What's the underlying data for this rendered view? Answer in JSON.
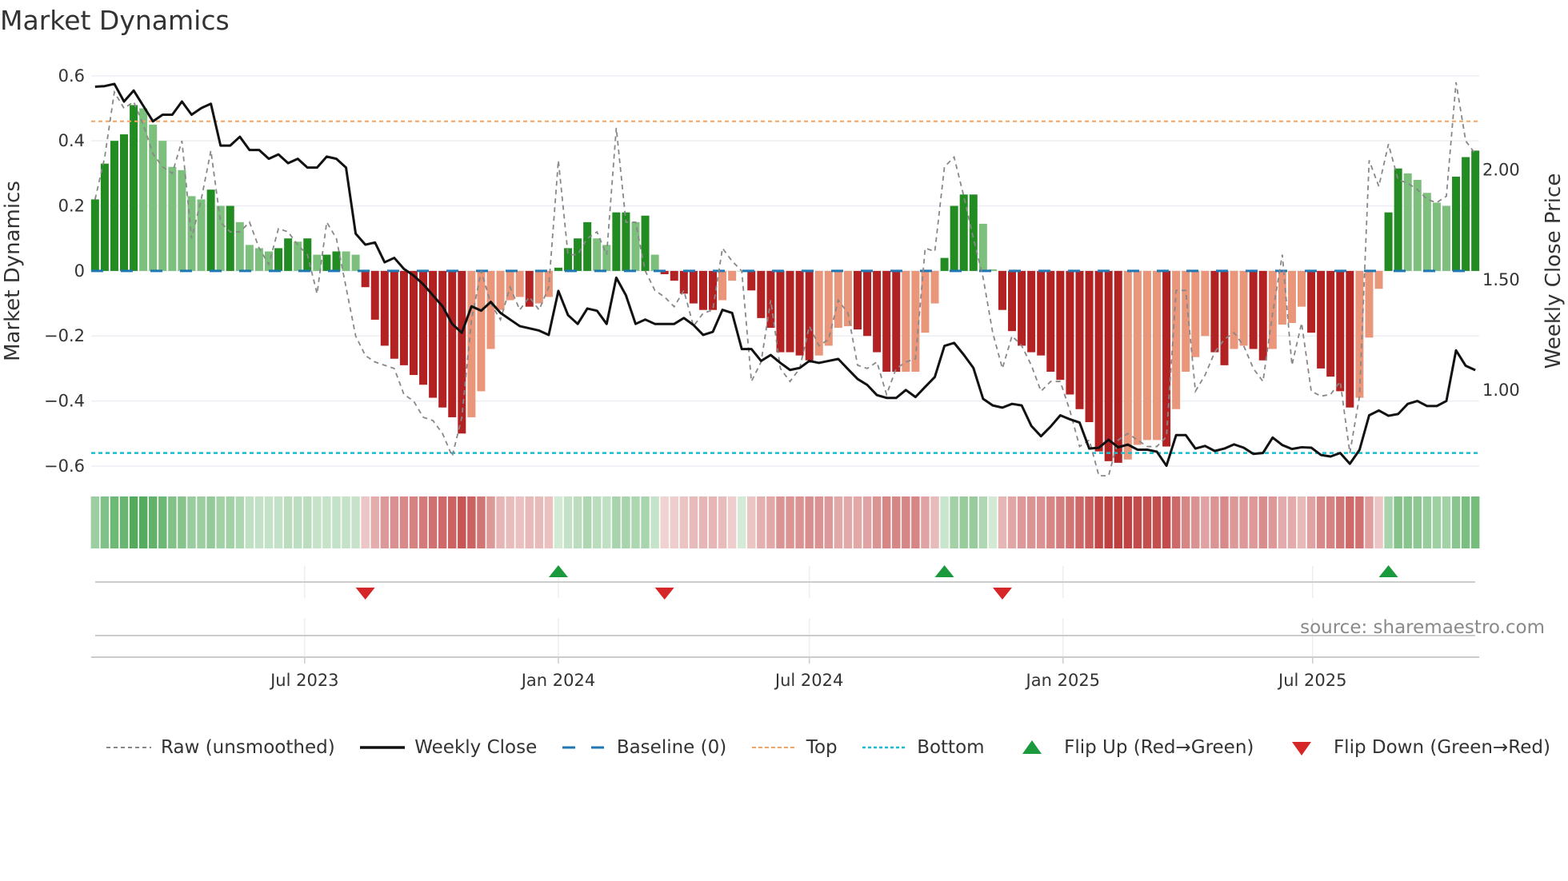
{
  "chart_data": {
    "type": "bar",
    "title": "Market Dynamics",
    "ylabel": "Market Dynamics",
    "y2label": "Weekly Close Price",
    "ylim": [
      -0.637,
      0.634
    ],
    "y2lim": [
      0.6,
      2.477
    ],
    "yticks": [
      {
        "value": 0.6,
        "label": "0.6"
      },
      {
        "value": 0.4,
        "label": "0.4"
      },
      {
        "value": 0.2,
        "label": "0.2"
      },
      {
        "value": 0,
        "label": "0"
      },
      {
        "value": -0.2,
        "label": "−0.2"
      },
      {
        "value": -0.4,
        "label": "−0.4"
      },
      {
        "value": -0.6,
        "label": "−0.6"
      }
    ],
    "y2ticks": [
      {
        "value": 2.0,
        "label": "2.00"
      },
      {
        "value": 1.5,
        "label": "1.50"
      },
      {
        "value": 1.0,
        "label": "1.00"
      }
    ],
    "xticks": [
      {
        "date": "2023-07-01",
        "label": "Jul 2023"
      },
      {
        "date": "2024-01-01",
        "label": "Jan 2024"
      },
      {
        "date": "2024-07-01",
        "label": "Jul 2024"
      },
      {
        "date": "2025-01-01",
        "label": "Jan 2025"
      },
      {
        "date": "2025-07-01",
        "label": "Jul 2025"
      }
    ],
    "start_date": "2023-01-30",
    "interval": "weekly",
    "values": [
      0.22,
      0.33,
      0.4,
      0.42,
      0.51,
      0.5,
      0.45,
      0.4,
      0.32,
      0.31,
      0.23,
      0.22,
      0.25,
      0.2,
      0.2,
      0.15,
      0.08,
      0.07,
      0.06,
      0.07,
      0.1,
      0.09,
      0.1,
      0.05,
      0.05,
      0.06,
      0.06,
      0.05,
      -0.05,
      -0.15,
      -0.23,
      -0.27,
      -0.29,
      -0.32,
      -0.35,
      -0.39,
      -0.42,
      -0.45,
      -0.5,
      -0.45,
      -0.37,
      -0.24,
      -0.12,
      -0.09,
      -0.08,
      -0.11,
      -0.1,
      -0.08,
      0.01,
      0.07,
      0.1,
      0.15,
      0.1,
      0.08,
      0.18,
      0.18,
      0.15,
      0.17,
      0.05,
      -0.01,
      -0.03,
      -0.07,
      -0.1,
      -0.12,
      -0.12,
      -0.09,
      -0.03,
      0.0,
      -0.06,
      -0.145,
      -0.175,
      -0.25,
      -0.25,
      -0.26,
      -0.275,
      -0.26,
      -0.23,
      -0.175,
      -0.17,
      -0.18,
      -0.2,
      -0.25,
      -0.31,
      -0.31,
      -0.31,
      -0.31,
      -0.19,
      -0.1,
      0.04,
      0.2,
      0.235,
      0.235,
      0.145,
      0.005,
      -0.12,
      -0.185,
      -0.23,
      -0.25,
      -0.26,
      -0.31,
      -0.335,
      -0.38,
      -0.425,
      -0.465,
      -0.555,
      -0.585,
      -0.59,
      -0.58,
      -0.535,
      -0.52,
      -0.52,
      -0.54,
      -0.425,
      -0.31,
      -0.265,
      -0.2,
      -0.25,
      -0.29,
      -0.24,
      -0.23,
      -0.24,
      -0.275,
      -0.24,
      -0.165,
      -0.16,
      -0.11,
      -0.19,
      -0.3,
      -0.325,
      -0.37,
      -0.42,
      -0.39,
      -0.205,
      -0.055,
      0.18,
      0.315,
      0.3,
      0.28,
      0.24,
      0.21,
      0.2,
      0.29,
      0.35,
      0.37
    ],
    "strong": [
      1,
      1,
      1,
      1,
      1,
      0,
      0,
      0,
      0,
      0,
      0,
      0,
      1,
      0,
      1,
      0,
      0,
      0,
      0,
      1,
      1,
      0,
      1,
      0,
      1,
      1,
      0,
      0,
      1,
      1,
      1,
      1,
      1,
      1,
      1,
      1,
      1,
      1,
      1,
      0,
      0,
      0,
      0,
      0,
      0,
      1,
      0,
      0,
      1,
      1,
      1,
      1,
      0,
      0,
      1,
      1,
      0,
      1,
      0,
      1,
      1,
      1,
      1,
      1,
      1,
      0,
      0,
      0,
      1,
      1,
      1,
      1,
      1,
      1,
      1,
      0,
      0,
      0,
      0,
      1,
      1,
      1,
      1,
      1,
      0,
      0,
      0,
      0,
      1,
      1,
      1,
      1,
      0,
      0,
      1,
      1,
      1,
      1,
      1,
      1,
      1,
      1,
      1,
      1,
      1,
      1,
      1,
      0,
      0,
      0,
      0,
      1,
      0,
      0,
      0,
      0,
      1,
      1,
      0,
      0,
      1,
      1,
      0,
      0,
      0,
      0,
      1,
      1,
      1,
      1,
      1,
      0,
      0,
      0,
      1,
      1,
      0,
      0,
      0,
      0,
      0,
      1,
      1,
      1
    ],
    "raw": [
      0.22,
      0.35,
      0.55,
      0.5,
      0.52,
      0.45,
      0.36,
      0.32,
      0.3,
      0.4,
      0.1,
      0.22,
      0.37,
      0.15,
      0.12,
      0.12,
      0.15,
      0.07,
      0.02,
      0.13,
      0.12,
      0.08,
      0.05,
      -0.07,
      0.15,
      0.1,
      -0.05,
      -0.2,
      -0.26,
      -0.28,
      -0.29,
      -0.3,
      -0.38,
      -0.4,
      -0.45,
      -0.46,
      -0.5,
      -0.57,
      -0.45,
      -0.15,
      0.0,
      -0.1,
      -0.15,
      -0.05,
      -0.12,
      -0.08,
      -0.12,
      -0.05,
      0.34,
      0.05,
      0.05,
      0.1,
      0.12,
      0.05,
      0.44,
      0.15,
      0.15,
      0.0,
      -0.06,
      -0.08,
      -0.11,
      -0.06,
      -0.17,
      -0.13,
      -0.12,
      0.07,
      0.03,
      0.0,
      -0.34,
      -0.28,
      -0.09,
      -0.3,
      -0.34,
      -0.3,
      -0.17,
      -0.23,
      -0.21,
      -0.09,
      -0.13,
      -0.29,
      -0.3,
      -0.28,
      -0.38,
      -0.3,
      -0.28,
      -0.27,
      0.07,
      0.06,
      0.32,
      0.35,
      0.23,
      0.1,
      -0.02,
      -0.19,
      -0.3,
      -0.2,
      -0.23,
      -0.29,
      -0.37,
      -0.34,
      -0.34,
      -0.43,
      -0.54,
      -0.52,
      -0.63,
      -0.63,
      -0.52,
      -0.5,
      -0.52,
      -0.54,
      -0.54,
      -0.51,
      -0.06,
      -0.06,
      -0.37,
      -0.32,
      -0.25,
      -0.21,
      -0.19,
      -0.23,
      -0.3,
      -0.34,
      -0.13,
      0.05,
      -0.29,
      -0.16,
      -0.37,
      -0.385,
      -0.38,
      -0.34,
      -0.56,
      -0.385,
      0.34,
      0.26,
      0.39,
      0.28,
      0.27,
      0.25,
      0.22,
      0.21,
      0.23,
      0.58,
      0.4,
      0.36
    ],
    "close": [
      2.377,
      2.38,
      2.39,
      2.31,
      2.36,
      2.29,
      2.22,
      2.25,
      2.25,
      2.31,
      2.25,
      2.28,
      2.3,
      2.11,
      2.11,
      2.15,
      2.09,
      2.09,
      2.05,
      2.07,
      2.03,
      2.05,
      2.01,
      2.01,
      2.06,
      2.05,
      2.01,
      1.71,
      1.66,
      1.67,
      1.58,
      1.6,
      1.55,
      1.52,
      1.48,
      1.43,
      1.38,
      1.3,
      1.26,
      1.38,
      1.36,
      1.4,
      1.35,
      1.32,
      1.29,
      1.28,
      1.27,
      1.25,
      1.45,
      1.34,
      1.3,
      1.37,
      1.36,
      1.3,
      1.51,
      1.43,
      1.3,
      1.32,
      1.3,
      1.3,
      1.3,
      1.327,
      1.295,
      1.25,
      1.264,
      1.364,
      1.35,
      1.186,
      1.186,
      1.132,
      1.159,
      1.123,
      1.091,
      1.1,
      1.132,
      1.123,
      1.132,
      1.141,
      1.095,
      1.05,
      1.023,
      0.977,
      0.964,
      0.964,
      1.0,
      0.968,
      1.014,
      1.059,
      1.2,
      1.214,
      1.16,
      1.1,
      0.96,
      0.93,
      0.92,
      0.937,
      0.93,
      0.837,
      0.79,
      0.834,
      0.885,
      0.867,
      0.852,
      0.734,
      0.738,
      0.774,
      0.74,
      0.752,
      0.729,
      0.729,
      0.72,
      0.656,
      0.795,
      0.795,
      0.734,
      0.746,
      0.723,
      0.734,
      0.753,
      0.738,
      0.71,
      0.714,
      0.784,
      0.75,
      0.732,
      0.74,
      0.738,
      0.705,
      0.698,
      0.714,
      0.665,
      0.728,
      0.885,
      0.907,
      0.883,
      0.891,
      0.937,
      0.95,
      0.927,
      0.927,
      0.95,
      1.18,
      1.11,
      1.09
    ],
    "top": 0.46,
    "bottom": -0.56,
    "baseline": 0,
    "flips_up": [
      "2024-01-01",
      "2024-10-07",
      "2025-08-25"
    ],
    "flips_down": [
      "2023-08-14",
      "2024-03-18",
      "2024-11-18"
    ],
    "colors": {
      "strong_pos": "#228b22",
      "weak_pos": "#7dc07d",
      "strong_neg": "#b22222",
      "weak_neg": "#e9967a",
      "close": "#111111",
      "raw": "#888888",
      "baseline": "#1f77b4",
      "top": "#f4a460",
      "bottom": "#17becf",
      "flip_up": "#1a9a3c",
      "flip_down": "#d62728",
      "strip_pos": "#3c9f46",
      "strip_neg": "#be3c3c"
    },
    "source": "source: sharemaestro.com",
    "legend": [
      {
        "key": "raw",
        "label": "Raw (unsmoothed)"
      },
      {
        "key": "close",
        "label": "Weekly Close"
      },
      {
        "key": "baseline",
        "label": "Baseline (0)"
      },
      {
        "key": "top",
        "label": "Top"
      },
      {
        "key": "bottom",
        "label": "Bottom"
      },
      {
        "key": "flip_up",
        "label": "Flip Up (Red→Green)"
      },
      {
        "key": "flip_down",
        "label": "Flip Down (Green→Red)"
      }
    ]
  }
}
